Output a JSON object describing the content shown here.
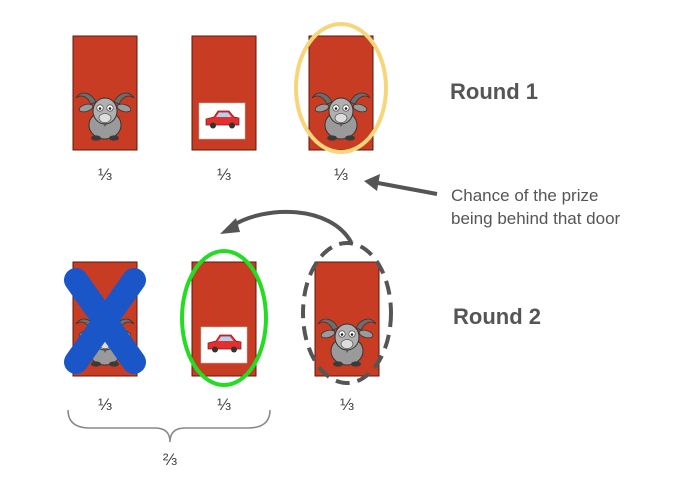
{
  "rounds": {
    "round1_label": "Round 1",
    "round2_label": "Round 2"
  },
  "round1": {
    "doors": [
      {
        "prize": "goat",
        "probability": "⅓"
      },
      {
        "prize": "car",
        "probability": "⅓"
      },
      {
        "prize": "goat",
        "probability": "⅓",
        "selected": true
      }
    ]
  },
  "round2": {
    "doors": [
      {
        "prize": "goat",
        "probability": "⅓",
        "eliminated": true
      },
      {
        "prize": "car",
        "probability": "⅓",
        "selected": true
      },
      {
        "prize": "goat",
        "probability": "⅓",
        "switched_from": true
      }
    ],
    "group_probability": "⅔"
  },
  "annotation": {
    "line1": "Chance of the prize",
    "line2": "being behind that door"
  },
  "colors": {
    "door": "#c83c23",
    "selection_round1": "#f7d57a",
    "selection_round2": "#22dd22",
    "cross": "#1a56c8",
    "dashed_ring": "#555555",
    "arrow": "#555555"
  },
  "icons": [
    "goat-icon",
    "car-icon",
    "cross-icon",
    "arrow-icon",
    "brace-icon"
  ]
}
